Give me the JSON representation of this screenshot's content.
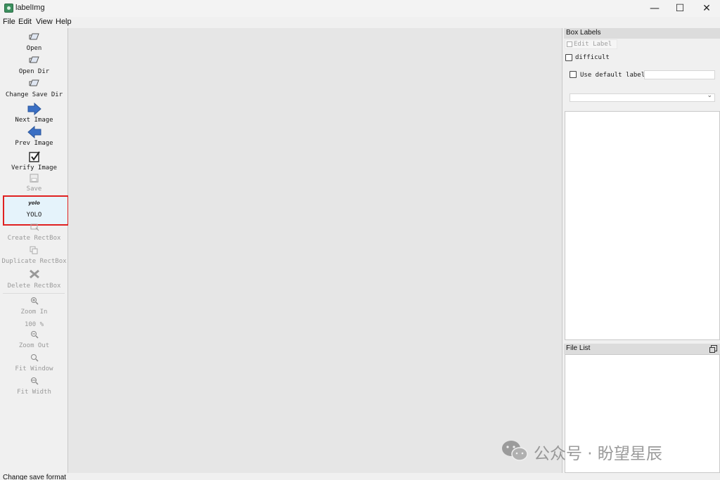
{
  "window": {
    "title": "labelImg",
    "minimize": "—",
    "maximize": "☐",
    "close": "✕"
  },
  "menu": [
    "File",
    "Edit",
    "View",
    "Help"
  ],
  "toolbar": {
    "open": "Open",
    "open_dir": "Open Dir",
    "change_save_dir": "Change Save Dir",
    "next_image": "Next Image",
    "prev_image": "Prev Image",
    "verify_image": "Verify Image",
    "save": "Save",
    "format_icon_text": "yolo",
    "format": "YOLO",
    "create_rectbox": "Create RectBox",
    "duplicate_rectbox": "Duplicate RectBox",
    "delete_rectbox": "Delete RectBox",
    "zoom_in": "Zoom In",
    "zoom_level": "100 %",
    "zoom_out": "Zoom Out",
    "fit_window": "Fit Window",
    "fit_width": "Fit Width"
  },
  "box_labels": {
    "title": "Box Labels",
    "edit_label": "Edit Label",
    "difficult": "difficult",
    "use_default_label": "Use default label",
    "default_label_value": "",
    "label_combo_value": ""
  },
  "file_list": {
    "title": "File List"
  },
  "status": "Change save format",
  "watermark": "公众号 · 盼望星辰",
  "colors": {
    "selection_border": "#e02020",
    "selection_fill": "#e5f3fb",
    "arrow_blue": "#3a6fc4"
  }
}
